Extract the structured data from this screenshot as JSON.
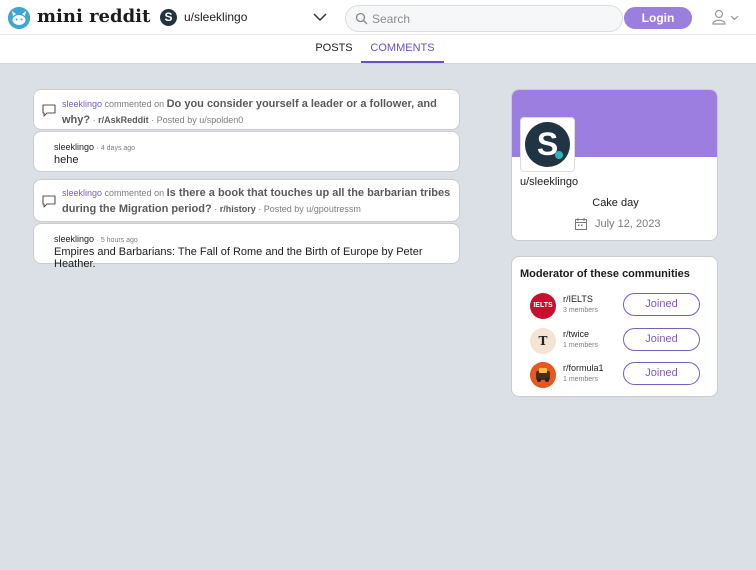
{
  "header": {
    "app_name": "mini reddit",
    "user_label": "u/sleeklingo",
    "search_placeholder": "Search",
    "login_label": "Login"
  },
  "tabs": [
    {
      "label": "POSTS",
      "active": false
    },
    {
      "label": "COMMENTS",
      "active": true
    }
  ],
  "comments": [
    {
      "user": "sleeklingo",
      "action": "commented on",
      "post_title": "Do you consider yourself a leader or a follower, and why?",
      "subreddit": "r/AskReddit",
      "posted_by": "Posted by u/spolden0",
      "reply_author": "sleeklingo",
      "reply_time": "4 days ago",
      "reply_body": "hehe"
    },
    {
      "user": "sleeklingo",
      "action": "commented on",
      "post_title": "Is there a book that touches up all the barbarian tribes during the Migration period?",
      "subreddit": "r/history",
      "posted_by": "Posted by u/gpoutressm",
      "reply_author": "sleeklingo",
      "reply_time": "5 hours ago",
      "reply_body": "Empires and Barbarians: The Fall of Rome and the Birth of Europe by Peter Heather."
    }
  ],
  "profile": {
    "username": "u/sleeklingo",
    "avatar_letter": "S",
    "cake_label": "Cake day",
    "cake_date": "July 12, 2023"
  },
  "moderator": {
    "title": "Moderator of these communities",
    "communities": [
      {
        "name": "r/IELTS",
        "members": "3 members",
        "button": "Joined",
        "icon_text": "IELTS"
      },
      {
        "name": "r/twice",
        "members": "1 members",
        "button": "Joined",
        "icon_text": "T"
      },
      {
        "name": "r/formula1",
        "members": "1 members",
        "button": "Joined",
        "icon_text": ""
      }
    ]
  },
  "colors": {
    "accent": "#9a7fde",
    "banner": "#9c7ee0",
    "link": "#7b5cbf",
    "background": "#dae0e6"
  }
}
